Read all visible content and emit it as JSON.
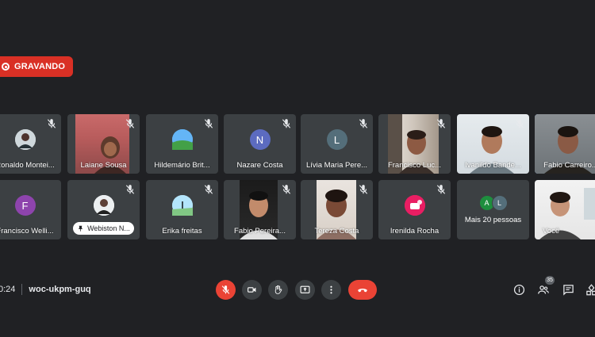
{
  "recording": {
    "label": "GRAVANDO",
    "color": "#d93025"
  },
  "participants": [
    {
      "name": "Ronaldo Montei..."
    },
    {
      "name": "Laiane Sousa"
    },
    {
      "name": "Hildemário Brit..."
    },
    {
      "name": "Nazare Costa",
      "initial": "N",
      "avatar_color": "#5c6bc0"
    },
    {
      "name": "Lívia Maria Pere...",
      "initial": "L",
      "avatar_color": "#546e7a"
    },
    {
      "name": "Francisco Luc..."
    },
    {
      "name": "Ivanildo Bande..."
    },
    {
      "name": "Fabio Carreiro..."
    },
    {
      "name": "Francisco Welli...",
      "initial": "F",
      "avatar_color": "#8e44ad"
    },
    {
      "name": "Webiston N..."
    },
    {
      "name": "Erika freitas"
    },
    {
      "name": "Fabio Pereira..."
    },
    {
      "name": "Tereza Costa"
    },
    {
      "name": "Irenilda Rocha"
    },
    {
      "label": "Mais 20 pessoas",
      "initials": [
        "A",
        "L"
      ],
      "colors": [
        "#1e8e3e",
        "#546e7a"
      ]
    },
    {
      "name": "Você"
    }
  ],
  "meeting": {
    "time": "0:24",
    "code": "woc-ukpm-guq"
  },
  "controls": {
    "mic": "mic-off-icon",
    "camera": "camera-icon",
    "hand": "raise-hand-icon",
    "present": "present-icon",
    "more": "more-options-icon",
    "end": "end-call-icon",
    "end_color": "#ea4335"
  },
  "right_controls": {
    "participant_count": "35"
  }
}
